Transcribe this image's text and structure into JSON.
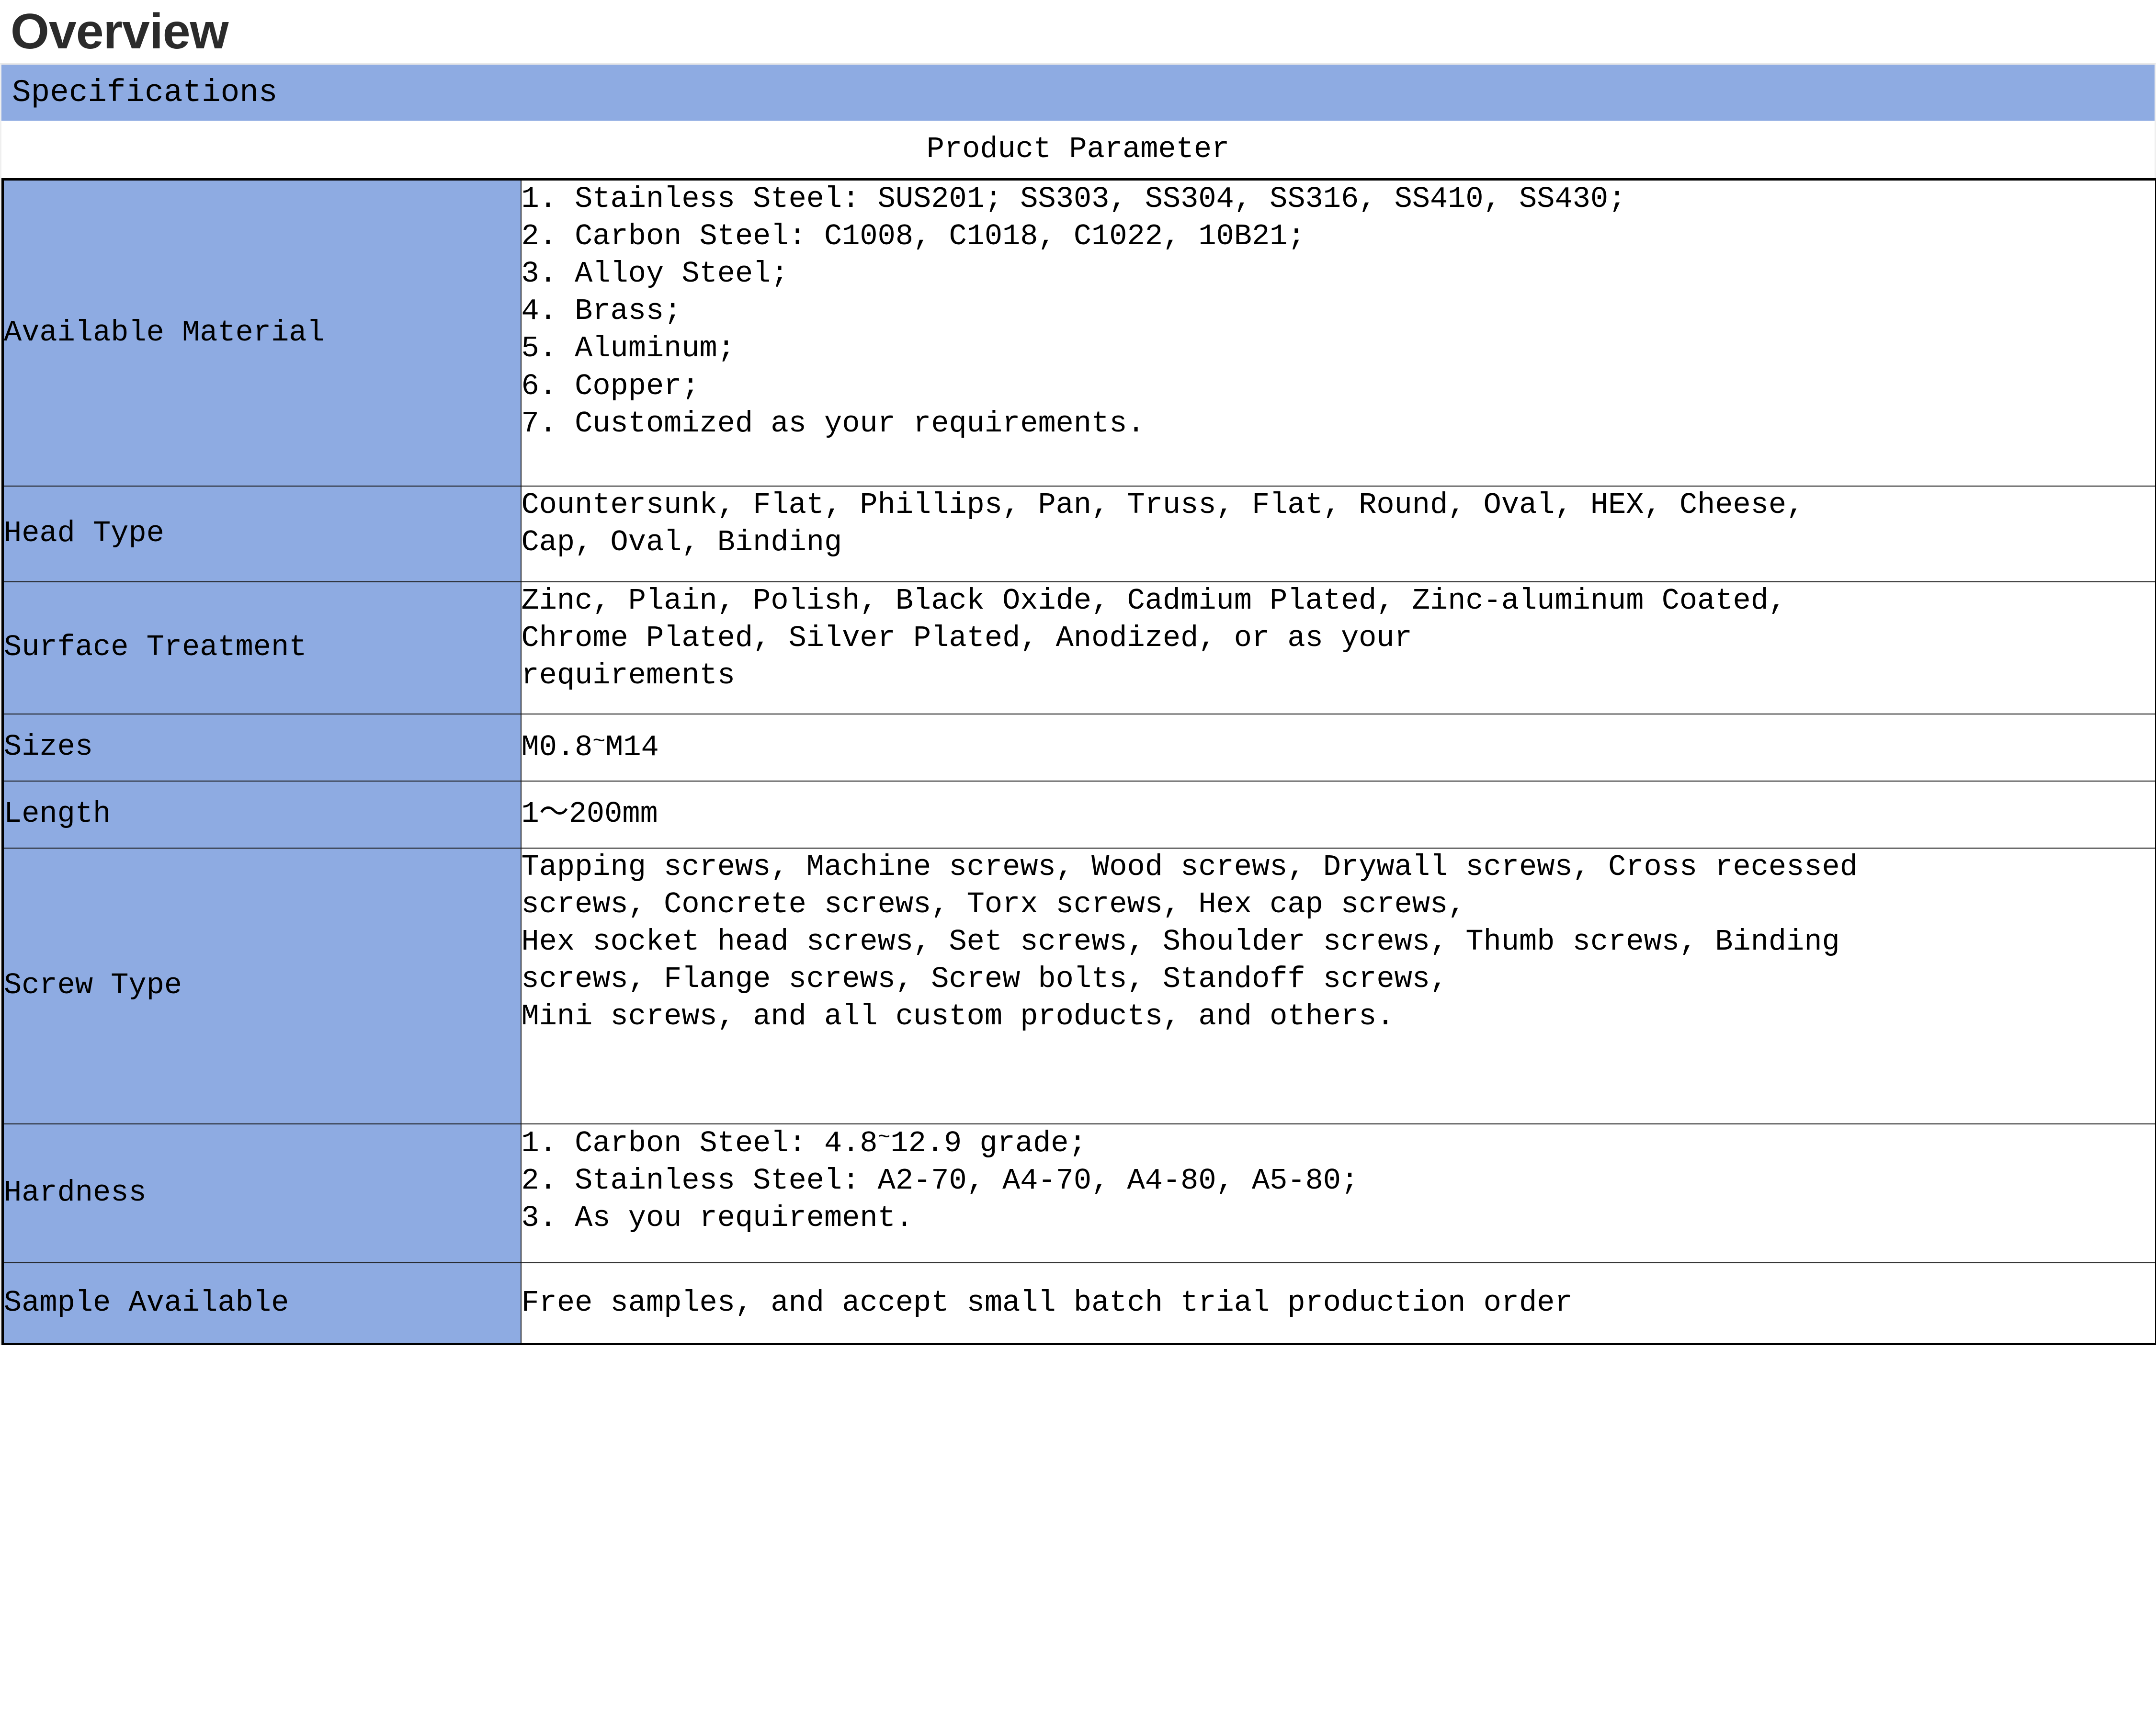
{
  "page": {
    "heading": "Overview",
    "section_band": "Specifications",
    "table_title": "Product Parameter",
    "accent_color": "#8EABE2",
    "heading_color": "#2b2b2b",
    "border_color": "#000000"
  },
  "table": {
    "rows": [
      {
        "label": "Available Material",
        "lines": [
          "1. Stainless Steel: SUS201; SS303, SS304, SS316, SS410, SS430;",
          "2. Carbon Steel: C1008, C1018, C1022, 10B21;",
          "3. Alloy Steel;",
          "4. Brass;",
          "5. Aluminum;",
          "6. Copper;",
          "7. Customized as your requirements."
        ]
      },
      {
        "label": "Head Type",
        "lines": [
          "Countersunk, Flat, Phillips, Pan, Truss, Flat, Round, Oval, HEX, Cheese,",
          "Cap, Oval, Binding"
        ]
      },
      {
        "label": "Surface Treatment",
        "lines": [
          "Zinc, Plain, Polish, Black Oxide, Cadmium Plated, Zinc-aluminum Coated,",
          "Chrome Plated, Silver Plated, Anodized, or as your",
          "requirements"
        ]
      },
      {
        "label": "Sizes",
        "lines": [
          "M0.8~M14"
        ]
      },
      {
        "label": "Length",
        "lines": [
          "1～200mm"
        ]
      },
      {
        "label": "Screw Type",
        "lines": [
          "Tapping screws, Machine screws, Wood screws, Drywall screws, Cross recessed",
          "screws, Concrete screws, Torx screws, Hex cap screws,",
          "Hex socket head screws, Set screws, Shoulder screws, Thumb screws, Binding",
          "screws, Flange screws, Screw bolts, Standoff screws,",
          "Mini screws, and all custom products, and others."
        ]
      },
      {
        "label": "Hardness",
        "lines": [
          "1. Carbon Steel: 4.8~12.9 grade;",
          "2. Stainless Steel: A2-70, A4-70, A4-80, A5-80;",
          "3. As you requirement."
        ]
      },
      {
        "label": "Sample Available",
        "lines": [
          "Free samples, and accept small batch trial production order"
        ]
      }
    ]
  }
}
